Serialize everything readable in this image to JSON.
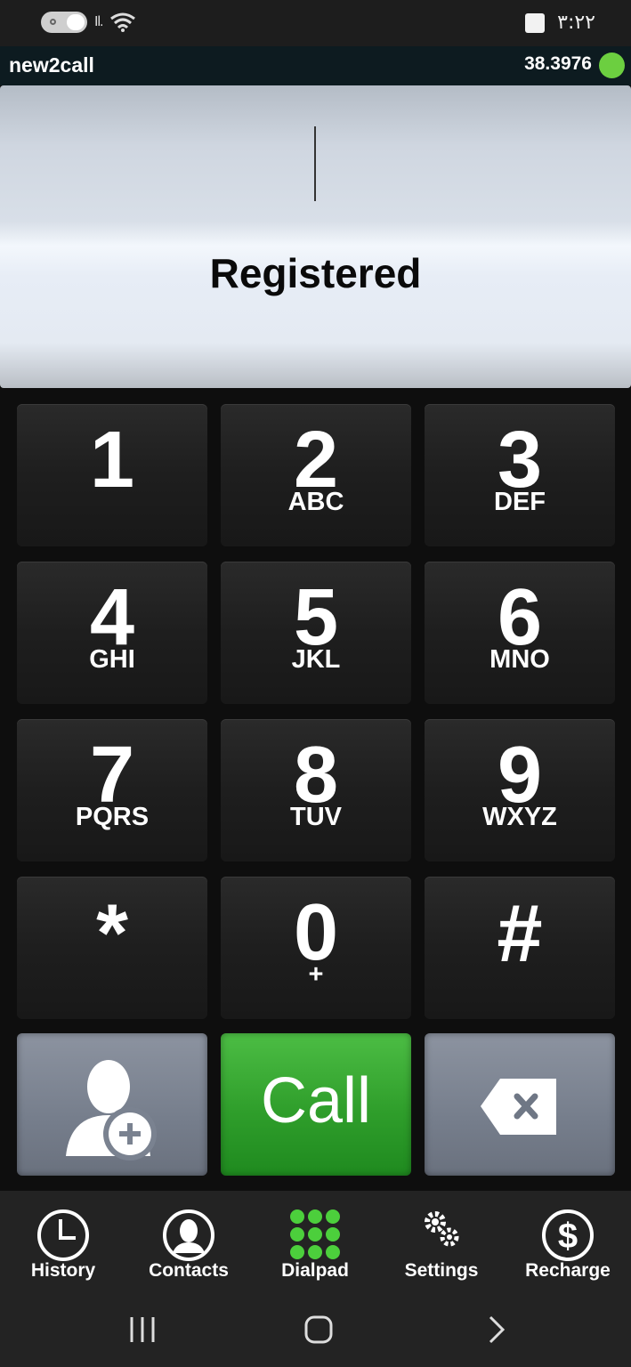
{
  "status_bar": {
    "time": "۳:۲۲",
    "signal_text": "Il.",
    "icons": [
      "toggle-pill-icon",
      "signal-icon",
      "wifi-icon",
      "notification-square-icon"
    ]
  },
  "app": {
    "title": "new2call",
    "balance": "38.3976",
    "status_color": "#6ccf40"
  },
  "display": {
    "number": "",
    "status": "Registered"
  },
  "keypad": {
    "keys": [
      {
        "digit": "1",
        "letters": ""
      },
      {
        "digit": "2",
        "letters": "ABC"
      },
      {
        "digit": "3",
        "letters": "DEF"
      },
      {
        "digit": "4",
        "letters": "GHI"
      },
      {
        "digit": "5",
        "letters": "JKL"
      },
      {
        "digit": "6",
        "letters": "MNO"
      },
      {
        "digit": "7",
        "letters": "PQRS"
      },
      {
        "digit": "8",
        "letters": "TUV"
      },
      {
        "digit": "9",
        "letters": "WXYZ"
      },
      {
        "digit": "*",
        "letters": ""
      },
      {
        "digit": "0",
        "letters": "+"
      },
      {
        "digit": "#",
        "letters": ""
      }
    ],
    "call_label": "Call",
    "call_color": "#2f9e2b"
  },
  "bottom_nav": {
    "items": [
      {
        "label": "History",
        "icon": "clock-icon"
      },
      {
        "label": "Contacts",
        "icon": "person-icon"
      },
      {
        "label": "Dialpad",
        "icon": "dialpad-icon",
        "active": true
      },
      {
        "label": "Settings",
        "icon": "gears-icon"
      },
      {
        "label": "Recharge",
        "icon": "dollar-icon"
      }
    ],
    "active_color": "#4ccf3c"
  },
  "system_nav": {
    "icons": [
      "recent-apps-icon",
      "home-icon",
      "back-icon"
    ]
  }
}
